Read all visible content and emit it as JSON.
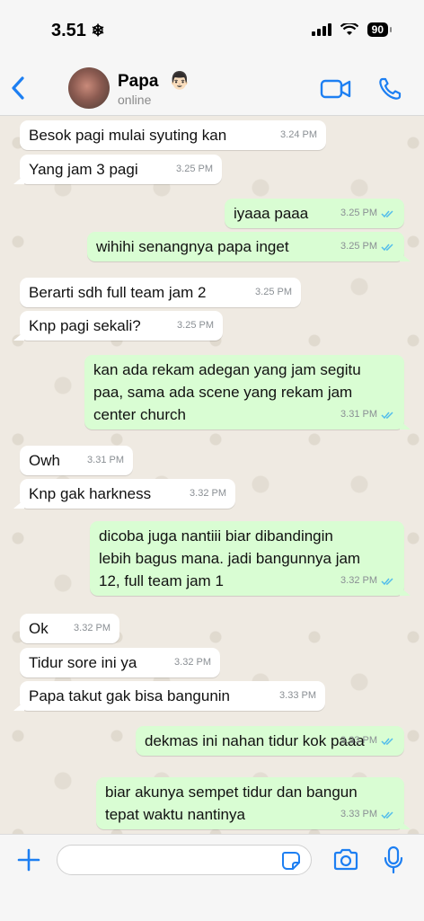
{
  "status_bar": {
    "time": "3.51",
    "time_icon": "snowflake-icon",
    "battery": "90"
  },
  "header": {
    "contact_name": "Papa",
    "contact_emoji": "👨🏻",
    "contact_status": "online"
  },
  "messages": [
    {
      "dir": "in",
      "text": "Besok pagi mulai syuting kan",
      "time": "3.24 PM"
    },
    {
      "dir": "in",
      "text": "Yang jam 3 pagi",
      "time": "3.25 PM"
    },
    {
      "dir": "out",
      "text": "iyaaa paaa",
      "time": "3.25 PM"
    },
    {
      "dir": "out",
      "text": "wihihi senangnya papa inget",
      "time": "3.25 PM"
    },
    {
      "dir": "in",
      "text": "Berarti sdh full team jam 2",
      "time": "3.25 PM"
    },
    {
      "dir": "in",
      "text": "Knp pagi sekali?",
      "time": "3.25 PM"
    },
    {
      "dir": "out",
      "text": "kan ada rekam adegan yang jam segitu\npaa, sama ada scene yang rekam jam\ncenter church",
      "time": "3.31 PM"
    },
    {
      "dir": "in",
      "text": "Owh",
      "time": "3.31 PM"
    },
    {
      "dir": "in",
      "text": "Knp gak harkness",
      "time": "3.32 PM"
    },
    {
      "dir": "out",
      "text": "dicoba juga nantiii biar dibandingin\nlebih bagus mana. jadi bangunnya jam\n12, full team jam 1",
      "time": "3.32 PM"
    },
    {
      "dir": "in",
      "text": "Ok",
      "time": "3.32 PM"
    },
    {
      "dir": "in",
      "text": "Tidur sore ini ya",
      "time": "3.32 PM"
    },
    {
      "dir": "in",
      "text": "Papa takut gak bisa bangunin",
      "time": "3.33 PM"
    },
    {
      "dir": "out",
      "text": "dekmas ini nahan tidur kok paaa",
      "time": "3.33 PM"
    },
    {
      "dir": "out",
      "text": "biar akunya sempet tidur dan bangun\ntepat waktu nantinya",
      "time": "3.33 PM"
    }
  ],
  "input": {
    "value": "",
    "placeholder": ""
  },
  "colors": {
    "accent": "#1d7ff2",
    "outgoing_bubble": "#d9fdd3",
    "incoming_bubble": "#ffffff",
    "chat_background": "#efeae2",
    "read_ticks": "#53bdeb"
  },
  "icons": {
    "back": "chevron-left-icon",
    "video": "video-camera-icon",
    "call": "phone-icon",
    "attach": "plus-icon",
    "sticker": "sticker-icon",
    "camera": "camera-icon",
    "mic": "microphone-icon",
    "read_status": "double-check-icon"
  }
}
